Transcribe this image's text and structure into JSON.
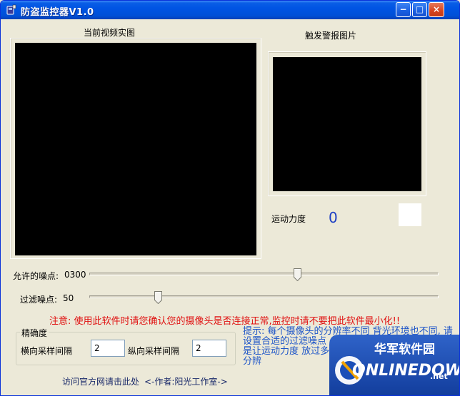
{
  "window": {
    "title": "防盗监控器V1.0",
    "minimize_label": "−",
    "maximize_label": "□",
    "close_label": "×"
  },
  "video_panel": {
    "title": "当前视频实图"
  },
  "alarm_panel": {
    "title": "触发警报图片"
  },
  "motion": {
    "label": "运动力度",
    "value": "0"
  },
  "noise_allowed": {
    "label": "允许的噪点:",
    "value": "0300",
    "level_fraction": 0.6
  },
  "noise_filter": {
    "label": "过滤噪点:",
    "value": "50",
    "level_fraction": 0.2
  },
  "notice": "注意: 使用此软件时请您确认您的摄像头是否连接正常,监控时请不要把此软件最小化!!",
  "precision": {
    "title": "精确度",
    "h_label": "横向采样间隔",
    "h_value": "2",
    "v_label": "纵向采样间隔",
    "v_value": "2"
  },
  "hint": "提示: 每个摄像头的分辨率不同 背光环境也不同, 请设置合适的过滤噪点 允许噪点数可以为0,但 的原理是让运动力度 放过多少运动力度而 合适的设置可以分辨",
  "footer": {
    "link": "访问官方网请击此处",
    "author": "<-作者:阳光工作室->"
  },
  "watermark": {
    "brand_cn": "华军软件园",
    "brand_en": "ONLINEDOWN",
    "suffix": ".net"
  },
  "colors": {
    "notice": "#e01010",
    "hint": "#1c54c8",
    "motion_value": "#1d3fc4",
    "titlebar": "#0054e3"
  }
}
